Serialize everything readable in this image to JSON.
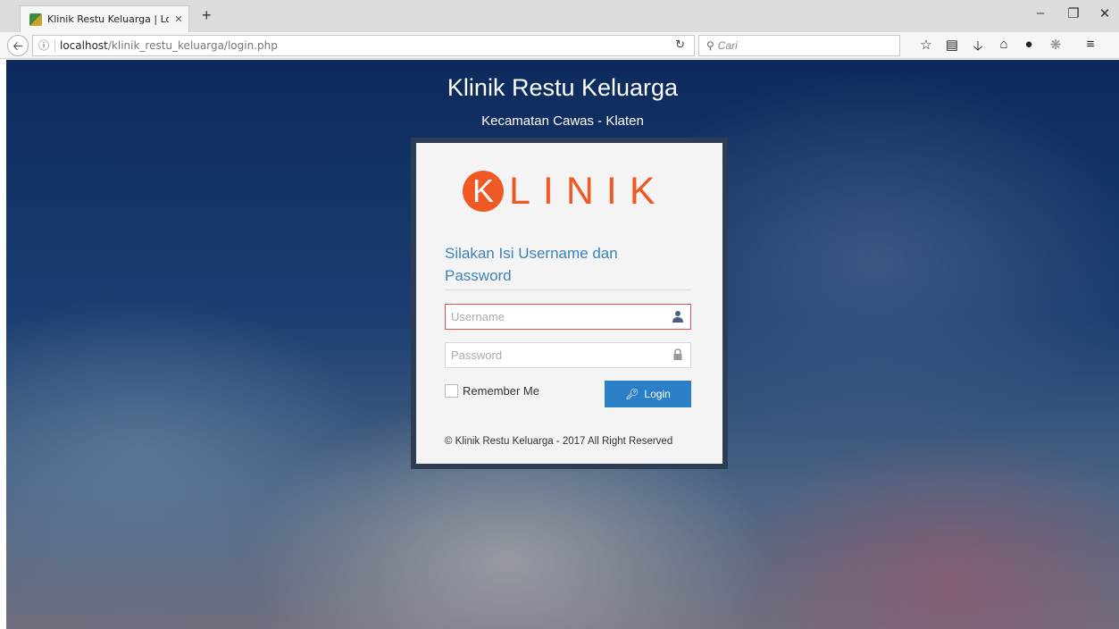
{
  "browser": {
    "tab_title": "Klinik Restu Keluarga | Login",
    "tab_close": "×",
    "new_tab": "+",
    "url_host": "localhost",
    "url_path": "/klinik_restu_keluarga/login.php",
    "search_placeholder": "Cari"
  },
  "page": {
    "title": "Klinik Restu Keluarga",
    "subtitle": "Kecamatan Cawas - Klaten"
  },
  "login": {
    "logo_letter": "K",
    "logo_text": "LINIK",
    "heading": "Silakan Isi Username dan Password",
    "username_placeholder": "Username",
    "password_placeholder": "Password",
    "remember_label": "Remember Me",
    "login_button": "Login",
    "footer": "© Klinik Restu Keluarga - 2017 All Right Reserved"
  },
  "colors": {
    "accent": "#ef5a24",
    "button": "#2b7fc6",
    "heading": "#3b82b8",
    "frame": "#2d3d55"
  }
}
